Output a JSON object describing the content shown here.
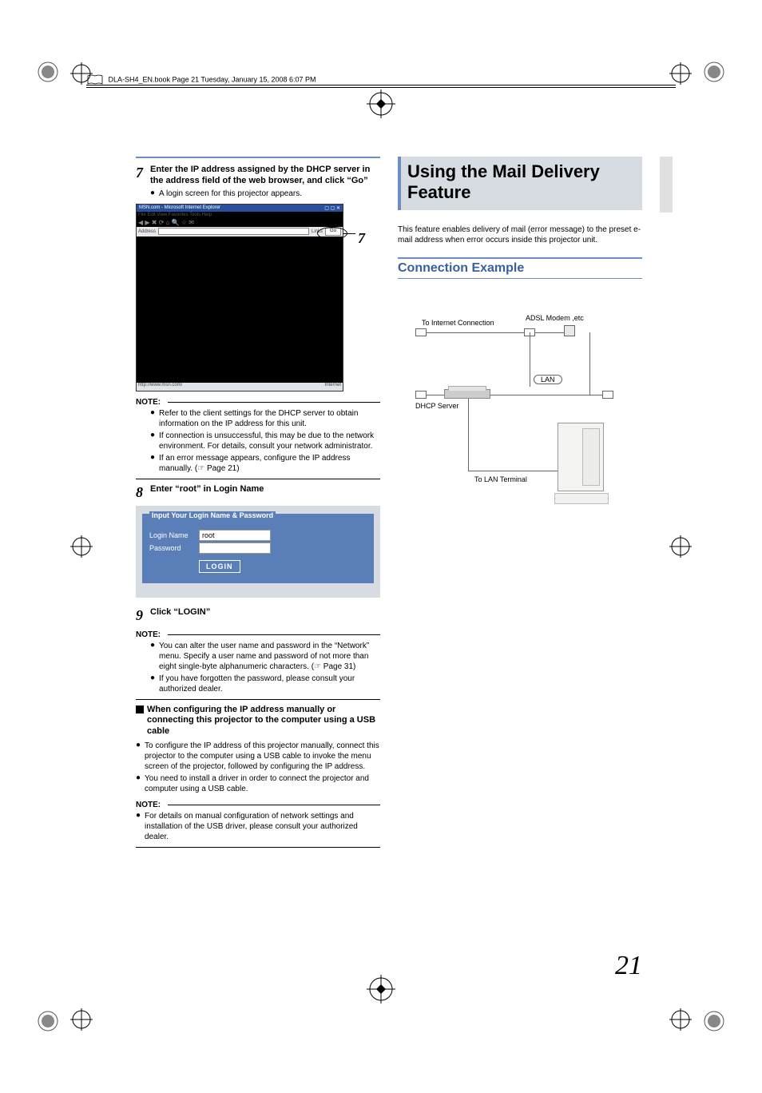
{
  "header": "DLA-SH4_EN.book  Page 21  Tuesday, January 15, 2008  6:07 PM",
  "page_number": "21",
  "left": {
    "step7": {
      "num": "7",
      "title_a": "Enter the IP address assigned by the DHCP server in the address field of the web browser, and click",
      "title_quote": "“Go”",
      "sub": "A login screen for this projector appears."
    },
    "browser": {
      "title": "MSN.com - Microsoft Internet Explorer",
      "menu": "File   Edit   View   Favorites   Tools   Help",
      "addr_label": "Address",
      "links": "Links",
      "go": "Go",
      "status_left": "http://www.msn.com/",
      "status_right": "Internet"
    },
    "callout7": "7",
    "note1_label": "NOTE:",
    "note1": [
      "Refer to the client settings for the DHCP server to obtain information on the IP address for this unit.",
      "If connection is unsuccessful, this may be due to the network environment. For details, consult your network administrator.",
      "If an error message appears, configure the IP address manually. (☞ Page 21)"
    ],
    "step8": {
      "num": "8",
      "title_a": "Enter",
      "title_quote": "“root”",
      "title_b": "in Login Name"
    },
    "login": {
      "legend": "Input Your Login Name & Password",
      "name_label": "Login Name",
      "name_value": "root",
      "pass_label": "Password",
      "button": "LOGIN"
    },
    "step9": {
      "num": "9",
      "title_a": "Click",
      "title_quote": "“LOGIN”"
    },
    "note2_label": "NOTE:",
    "note2": [
      "You can alter the user name and password in the “Network” menu. Specify a user name and password of not more than eight single-byte alphanumeric characters. (☞ Page 31)",
      "If you have forgotten the password, please consult your authorized dealer."
    ],
    "subhead": "When configuring the IP address manually or connecting this projector to the computer using a USB cable",
    "sub_bullets": [
      "To configure the IP address of this projector manually, connect this projector to the computer using a USB cable to invoke the menu screen of the projector, followed by configuring the IP address.",
      "You need to install a driver in order to connect the projector and computer using a USB cable."
    ],
    "note3_label": "NOTE:",
    "note3": [
      "For details on manual configuration of network settings and installation of the USB driver, please consult your authorized dealer."
    ]
  },
  "right": {
    "title": "Using the Mail Delivery Feature",
    "desc": "This feature enables delivery of mail (error message) to the preset e-mail address when error occurs inside this projector unit.",
    "section": "Connection Example",
    "labels": {
      "internet": "To Internet Connection",
      "adsl": "ADSL Modem ,etc",
      "lan": "LAN",
      "dhcp": "DHCP Server",
      "lanterm": "To LAN Terminal"
    }
  }
}
